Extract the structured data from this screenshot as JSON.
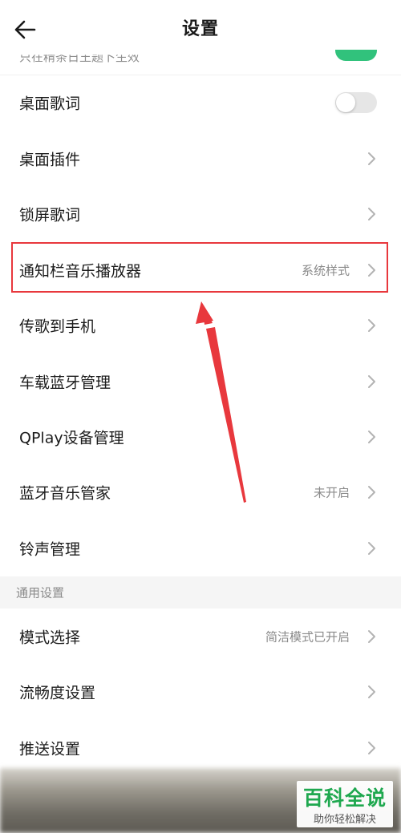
{
  "header": {
    "title": "设置",
    "partial_row_text": "只在精条日王题卜生效"
  },
  "rows": [
    {
      "label": "桌面歌词",
      "value": "",
      "control": "toggle",
      "toggle_on": false
    },
    {
      "label": "桌面插件",
      "value": "",
      "control": "chevron"
    },
    {
      "label": "锁屏歌词",
      "value": "",
      "control": "chevron"
    },
    {
      "label": "通知栏音乐播放器",
      "value": "系统样式",
      "control": "chevron"
    },
    {
      "label": "传歌到手机",
      "value": "",
      "control": "chevron"
    },
    {
      "label": "车载蓝牙管理",
      "value": "",
      "control": "chevron"
    },
    {
      "label": "QPlay设备管理",
      "value": "",
      "control": "chevron"
    },
    {
      "label": "蓝牙音乐管家",
      "value": "未开启",
      "control": "chevron"
    },
    {
      "label": "铃声管理",
      "value": "",
      "control": "chevron"
    }
  ],
  "section": {
    "label": "通用设置"
  },
  "general_rows": [
    {
      "label": "模式选择",
      "value": "简洁模式已开启",
      "control": "chevron"
    },
    {
      "label": "流畅度设置",
      "value": "",
      "control": "chevron"
    },
    {
      "label": "推送设置",
      "value": "",
      "control": "chevron"
    }
  ],
  "watermark": {
    "main": "百科全说",
    "sub": "助你轻松解决"
  },
  "colors": {
    "accent_green": "#31c27c",
    "highlight_red": "#e8383d",
    "watermark_green": "#1fa84f",
    "section_bg": "#f5f5f5"
  },
  "icons": {
    "back": "back-arrow-icon",
    "chevron": "chevron-right-icon"
  }
}
